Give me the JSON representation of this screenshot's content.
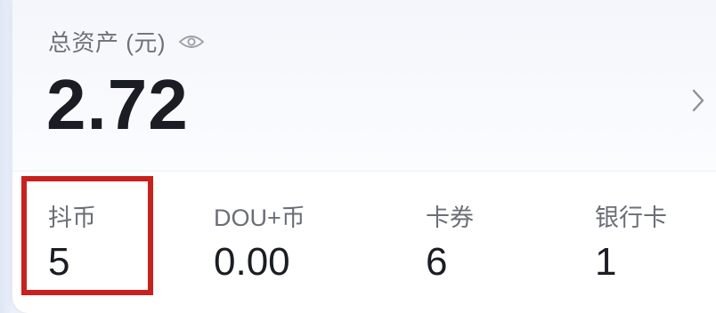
{
  "total_assets": {
    "label": "总资产 (元)",
    "value": "2.72",
    "visibility_icon": "eye-icon",
    "navigate_icon": "chevron-right-icon"
  },
  "stats": [
    {
      "label": "抖币",
      "value": "5"
    },
    {
      "label": "DOU+币",
      "value": "0.00"
    },
    {
      "label": "卡券",
      "value": "6"
    },
    {
      "label": "银行卡",
      "value": "1"
    }
  ],
  "highlight": {
    "target": "抖币",
    "color": "#c8211e"
  },
  "colors": {
    "value_text": "#1b1d24",
    "label_text": "#6b6e77",
    "highlight": "#c8211e"
  }
}
